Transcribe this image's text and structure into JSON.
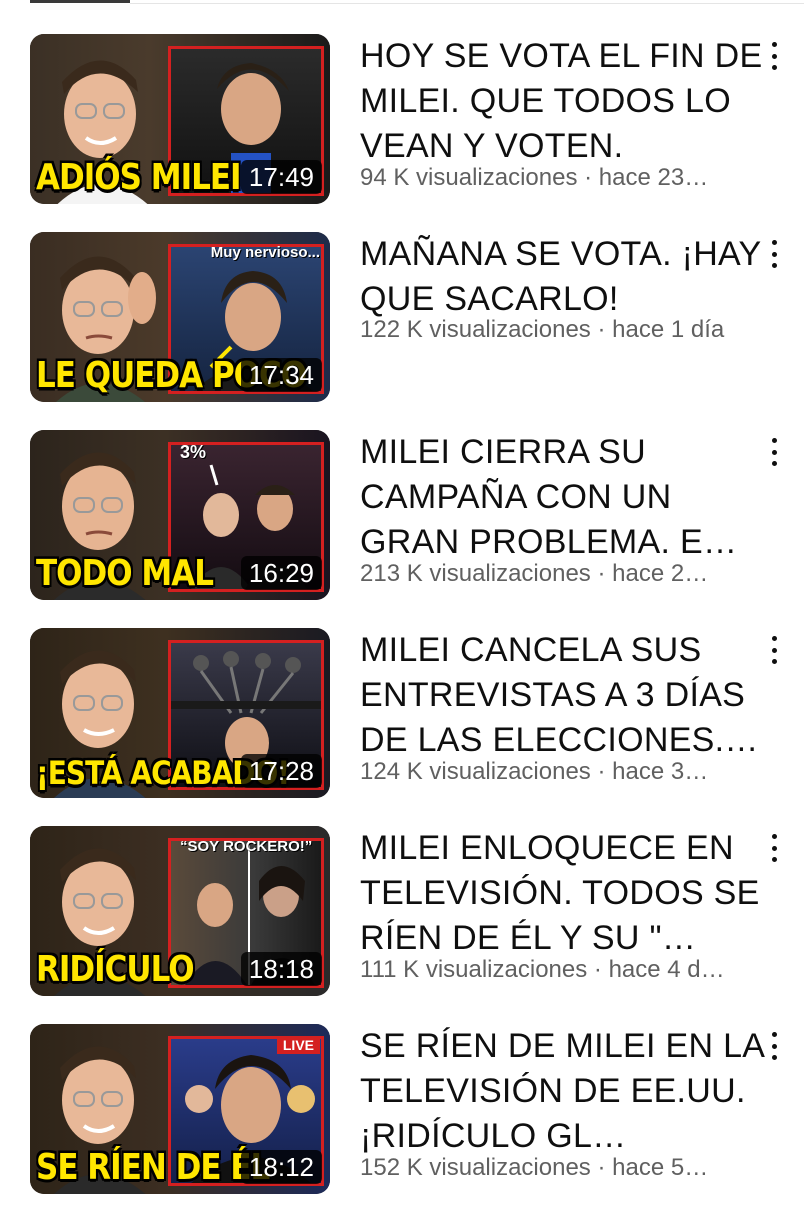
{
  "videos": [
    {
      "thumbnail_caption": "ADIÓS MILEI",
      "thumbnail_tag": "",
      "duration": "17:49",
      "title": "HOY SE VOTA EL FIN DE MILEI. QUE TODOS LO VEAN Y VOTEN.",
      "meta": "94 K visualizaciones · hace 23…"
    },
    {
      "thumbnail_caption": "LE QUEDA POCO",
      "thumbnail_tag": "Muy nervioso...",
      "duration": "17:34",
      "title": "MAÑANA SE VOTA. ¡HAY QUE SACARLO!",
      "meta": "122 K visualizaciones · hace 1 día"
    },
    {
      "thumbnail_caption": "TODO MAL",
      "thumbnail_tag": "3%",
      "duration": "16:29",
      "title": "MILEI CIERRA SU CAMPAÑA CON UN GRAN PROBLEMA. E…",
      "meta": "213 K visualizaciones · hace 2…"
    },
    {
      "thumbnail_caption": "¡ESTÁ ACABADO!",
      "thumbnail_tag": "",
      "duration": "17:28",
      "title": "MILEI CANCELA SUS ENTREVISTAS A 3 DÍAS DE LAS ELECCIONES.…",
      "meta": "124 K visualizaciones · hace 3…"
    },
    {
      "thumbnail_caption": "RIDÍCULO",
      "thumbnail_tag": "“SOY ROCKERO!”",
      "duration": "18:18",
      "title": "MILEI ENLOQUECE EN TELEVISIÓN. TODOS SE RÍEN DE ÉL Y SU \"…",
      "meta": "111 K visualizaciones · hace 4 d…"
    },
    {
      "thumbnail_caption": "SE RÍEN DE ÉL",
      "thumbnail_tag": "LIVE",
      "duration": "18:12",
      "title": "SE RÍEN DE MILEI EN LA TELEVISIÓN DE EE.UU. ¡RIDÍCULO GL…",
      "meta": "152 K visualizaciones · hace 5…"
    }
  ],
  "colors": {
    "caption": "#ffe600",
    "inset_border": "#d42020",
    "meta_text": "#606060",
    "title_text": "#0f0f0f"
  }
}
